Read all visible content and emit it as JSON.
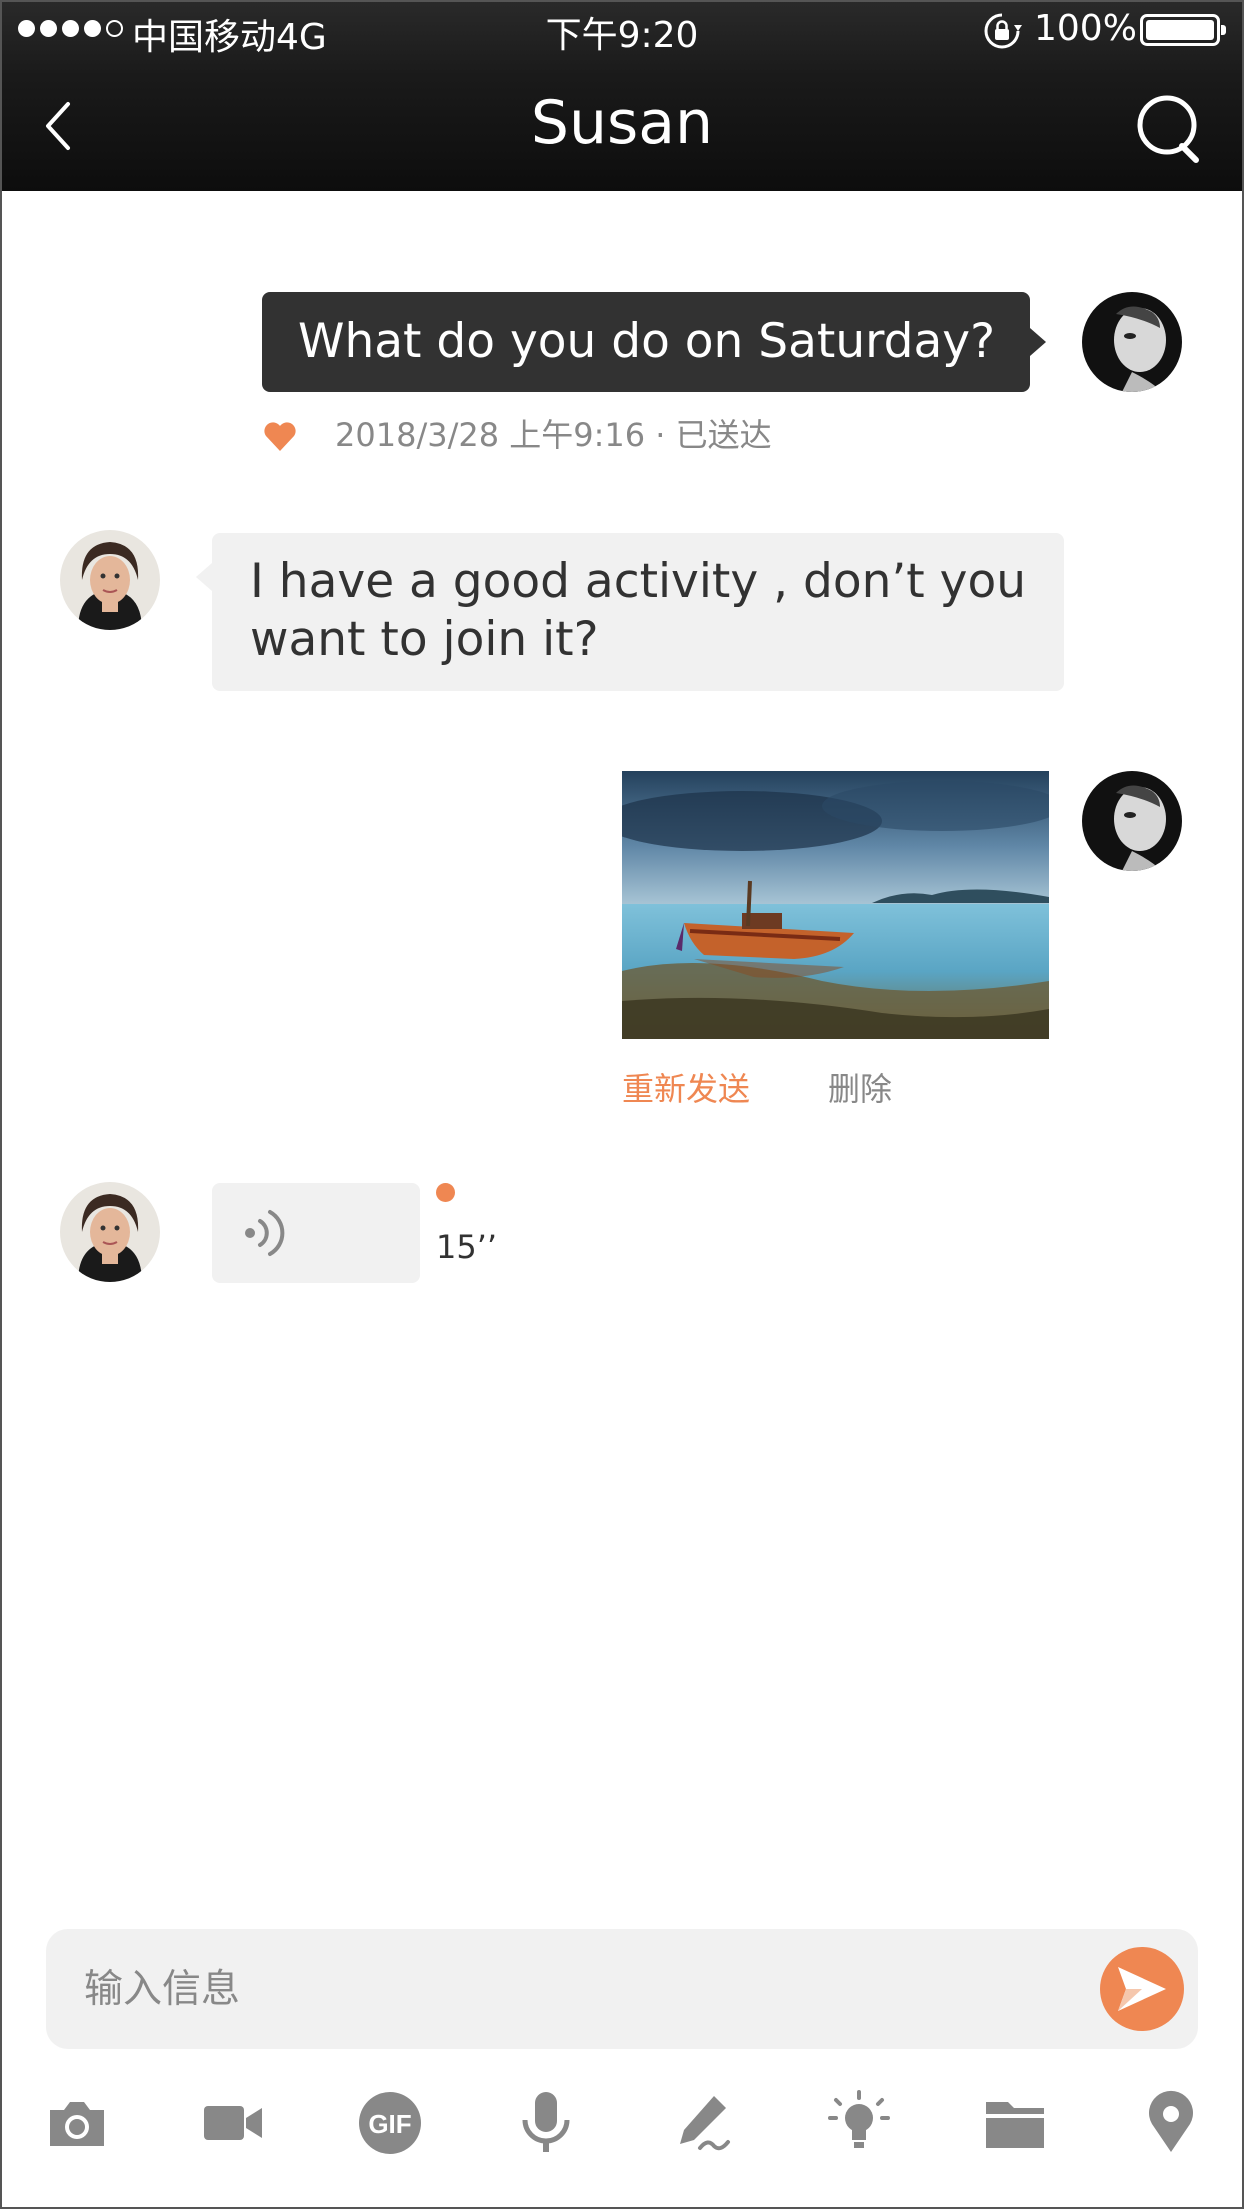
{
  "status_bar": {
    "carrier": "中国移动4G",
    "time": "下午9:20",
    "battery": "100%"
  },
  "nav": {
    "title": "Susan"
  },
  "messages": {
    "outgoing_text": "What do you do on Saturday?",
    "outgoing_date": "2018/3/28 上午9:16",
    "outgoing_status": "· 已送达",
    "incoming_line1": "I have a good activity , don’t  you",
    "incoming_line2": "want to join it?",
    "photo_resend": "重新发送",
    "photo_delete": "删除",
    "voice_duration": "15’’"
  },
  "composer": {
    "placeholder": "输入信息"
  },
  "toolbar": {
    "gif_label": "GIF"
  },
  "colors": {
    "accent": "#ef8752",
    "dark_bubble": "#323232",
    "light_bubble": "#f1f1f1",
    "meta_text": "#888888"
  }
}
